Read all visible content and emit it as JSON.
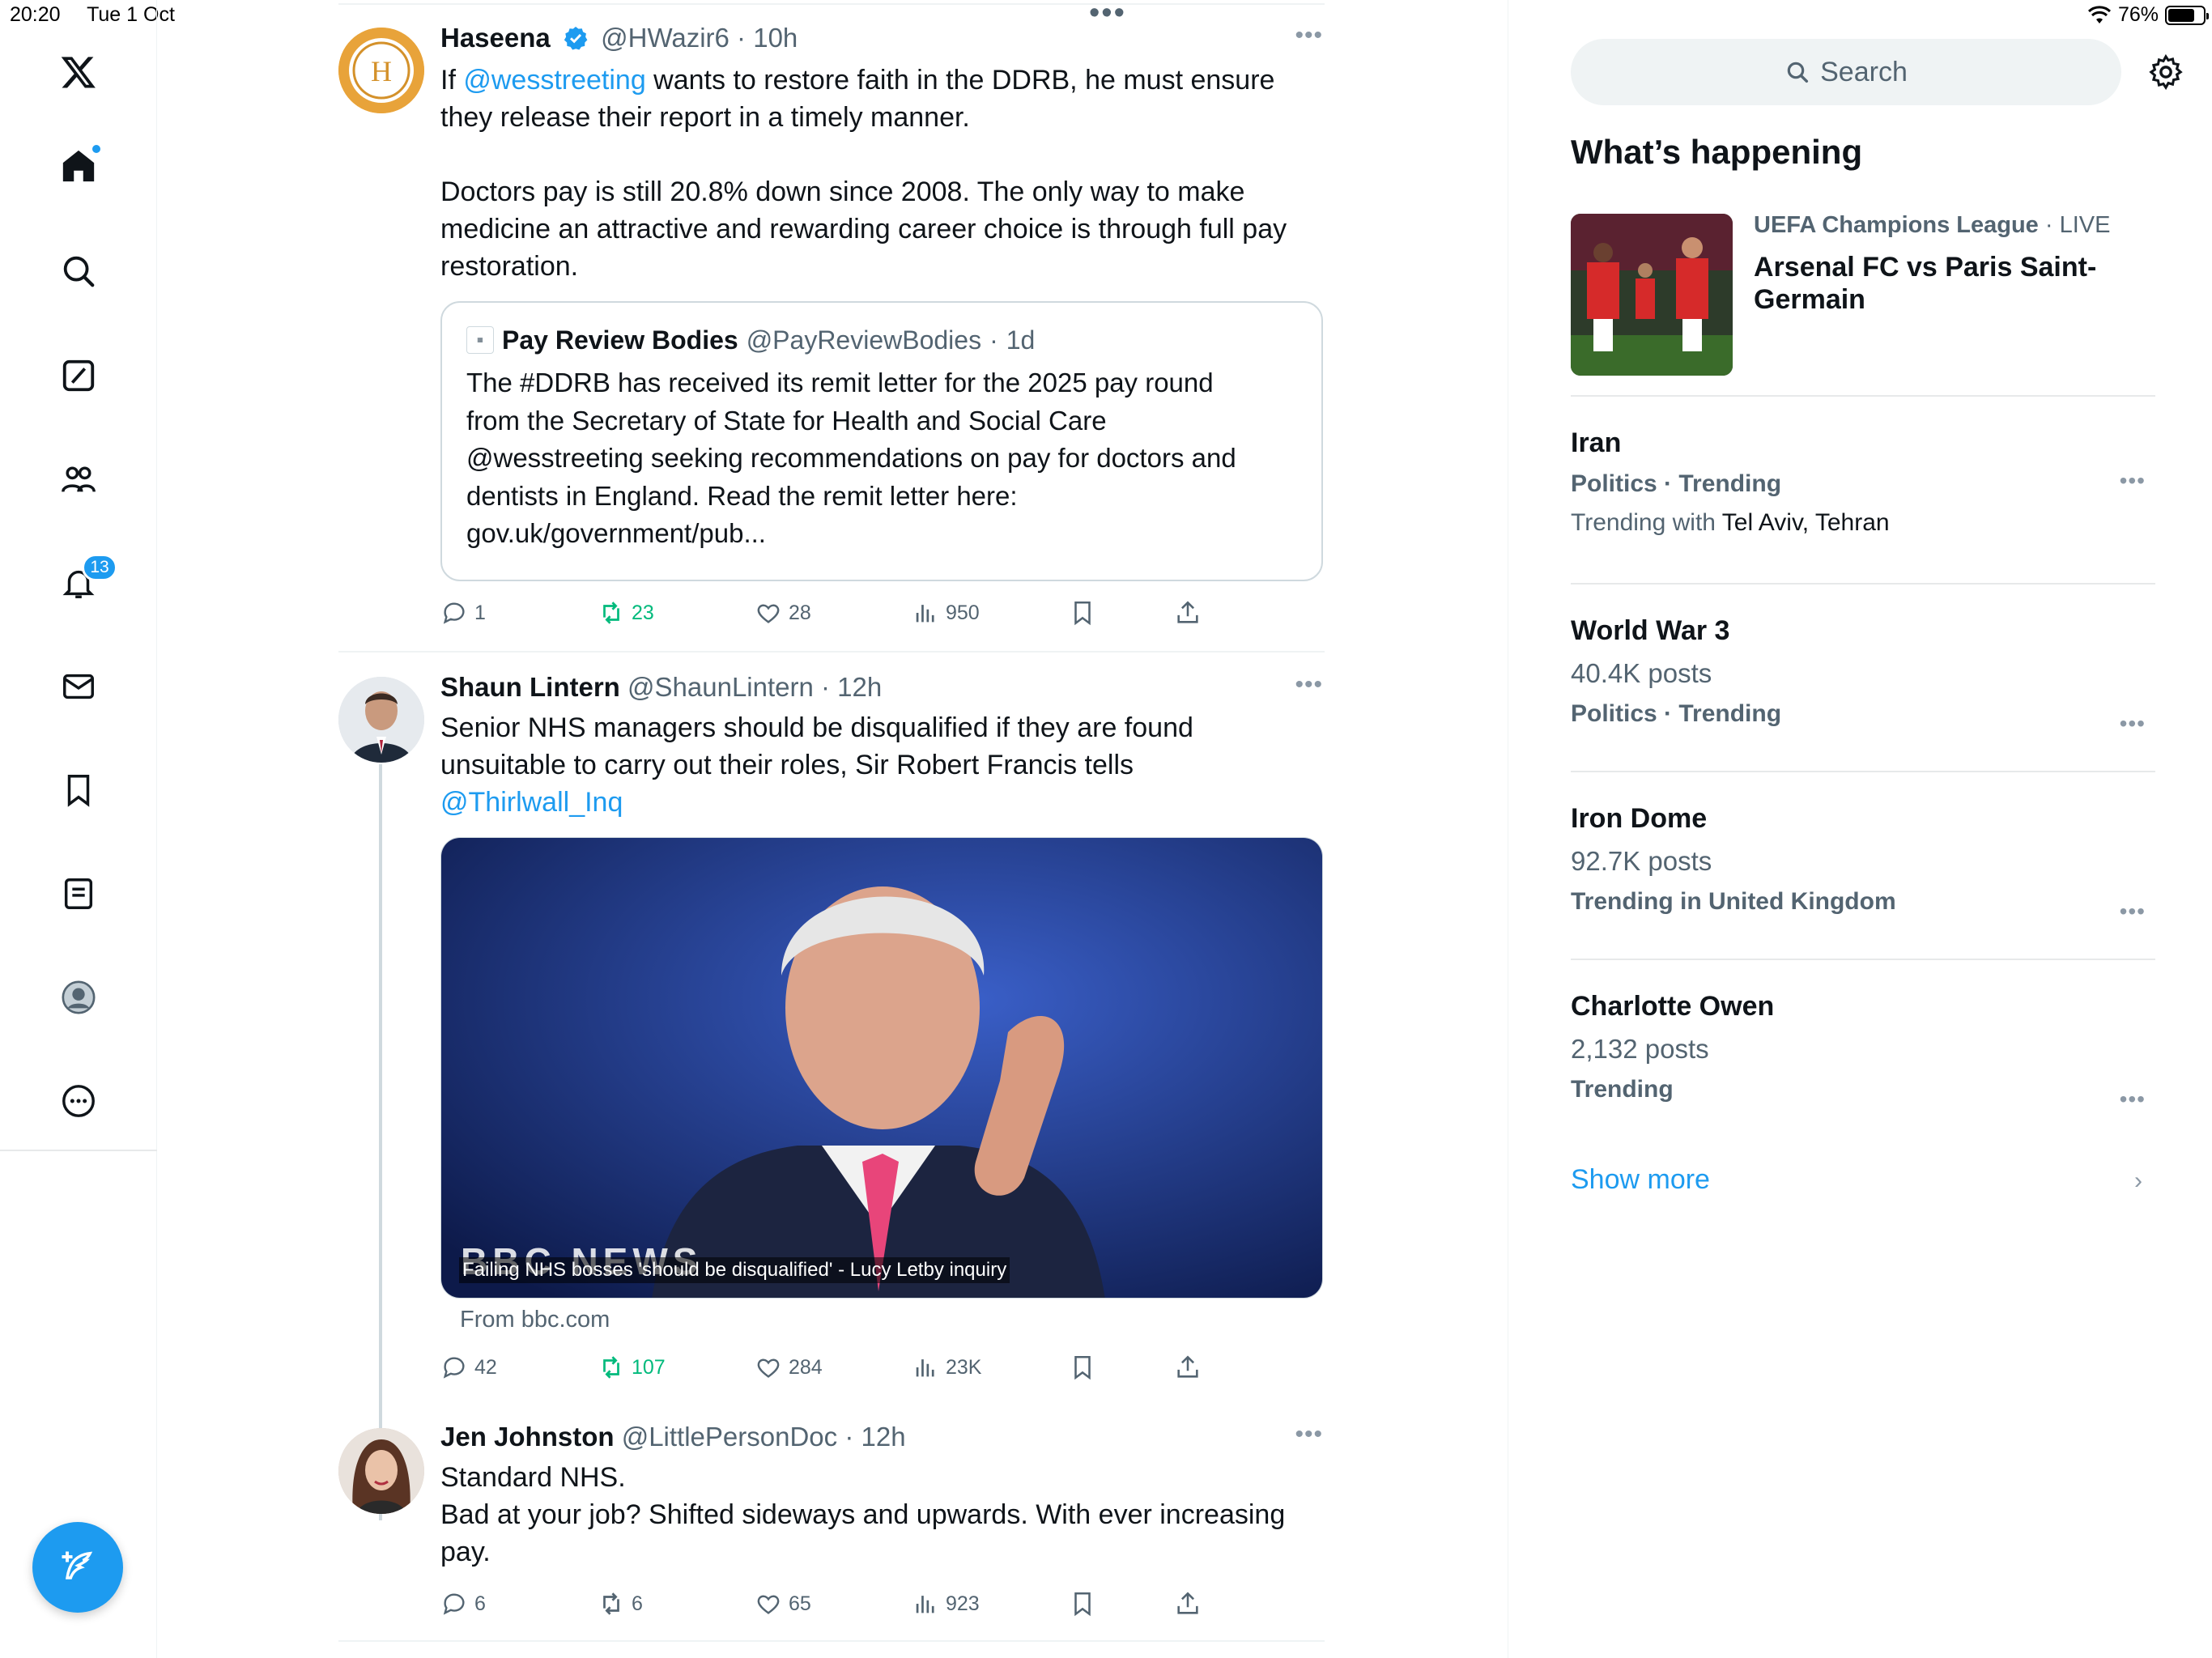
{
  "status_bar": {
    "time": "20:20",
    "date": "Tue 1 Oct",
    "battery": "76%",
    "battery_level": 0.76
  },
  "nav": {
    "items": [
      "x-logo",
      "home",
      "explore",
      "grok",
      "communities",
      "notifications",
      "messages",
      "bookmarks",
      "lists",
      "profile",
      "more"
    ],
    "notifications_badge": "13"
  },
  "feed": {
    "tweets": [
      {
        "name": "Haseena",
        "handle": "@HWazir6",
        "time": "10h",
        "verified": true,
        "text_prefix": "If ",
        "mention": "@wesstreeting",
        "text_rest": " wants to restore faith in the DDRB, he must ensure\nthey release their report in a timely manner.\n\nDoctors pay is still 20.8% down since 2008. The only way to make\nmedicine an attractive and rewarding career choice is through full pay\nrestoration.",
        "quote": {
          "name": "Pay Review Bodies",
          "handle": "@PayReviewBodies",
          "time": "1d",
          "text": "The #DDRB has received its remit letter for the 2025 pay round\nfrom the Secretary of State for Health and Social Care\n@wesstreeting seeking recommendations on pay for doctors and\ndentists in England. Read the remit letter here:\ngov.uk/government/pub..."
        },
        "stats": {
          "replies": "1",
          "reposts": "23",
          "likes": "28",
          "views": "950"
        }
      },
      {
        "name": "Shaun Lintern",
        "handle": "@ShaunLintern",
        "time": "12h",
        "text": "Senior NHS managers should be disqualified if they are found\nunsuitable to carry out their roles, Sir Robert Francis tells",
        "mention": "@Thirlwall_Inq",
        "media_logo": "BBC NEWS",
        "media_caption": "Failing NHS bosses 'should be disqualified' - Lucy Letby inquiry",
        "from": "From bbc.com",
        "stats": {
          "replies": "42",
          "reposts": "107",
          "likes": "284",
          "views": "23K"
        }
      },
      {
        "name": "Jen Johnston",
        "handle": "@LittlePersonDoc",
        "time": "12h",
        "text": "Standard NHS.\nBad at your job? Shifted sideways and upwards. With ever increasing\npay.",
        "stats": {
          "replies": "6",
          "reposts": "6",
          "likes": "65",
          "views": "923"
        }
      }
    ]
  },
  "sidebar": {
    "search_placeholder": "Search",
    "section_title": "What’s happening",
    "featured": {
      "category": "UEFA Champions League",
      "status": "LIVE",
      "title": "Arsenal FC vs Paris Saint-Germain"
    },
    "trends": [
      {
        "name": "Iran",
        "category": "Politics · Trending",
        "with_label": "Trending with",
        "with_value": "Tel Aviv, Tehran"
      },
      {
        "name": "World War 3",
        "count": "40.4K posts",
        "category": "Politics · Trending"
      },
      {
        "name": "Iron Dome",
        "count": "92.7K posts",
        "category": "Trending in United Kingdom"
      },
      {
        "name": "Charlotte Owen",
        "count": "2,132 posts",
        "category": "Trending"
      }
    ],
    "show_more": "Show more"
  },
  "colors": {
    "accent": "#1d9bf0",
    "repost_green": "#00ba7c",
    "muted": "#536471"
  }
}
